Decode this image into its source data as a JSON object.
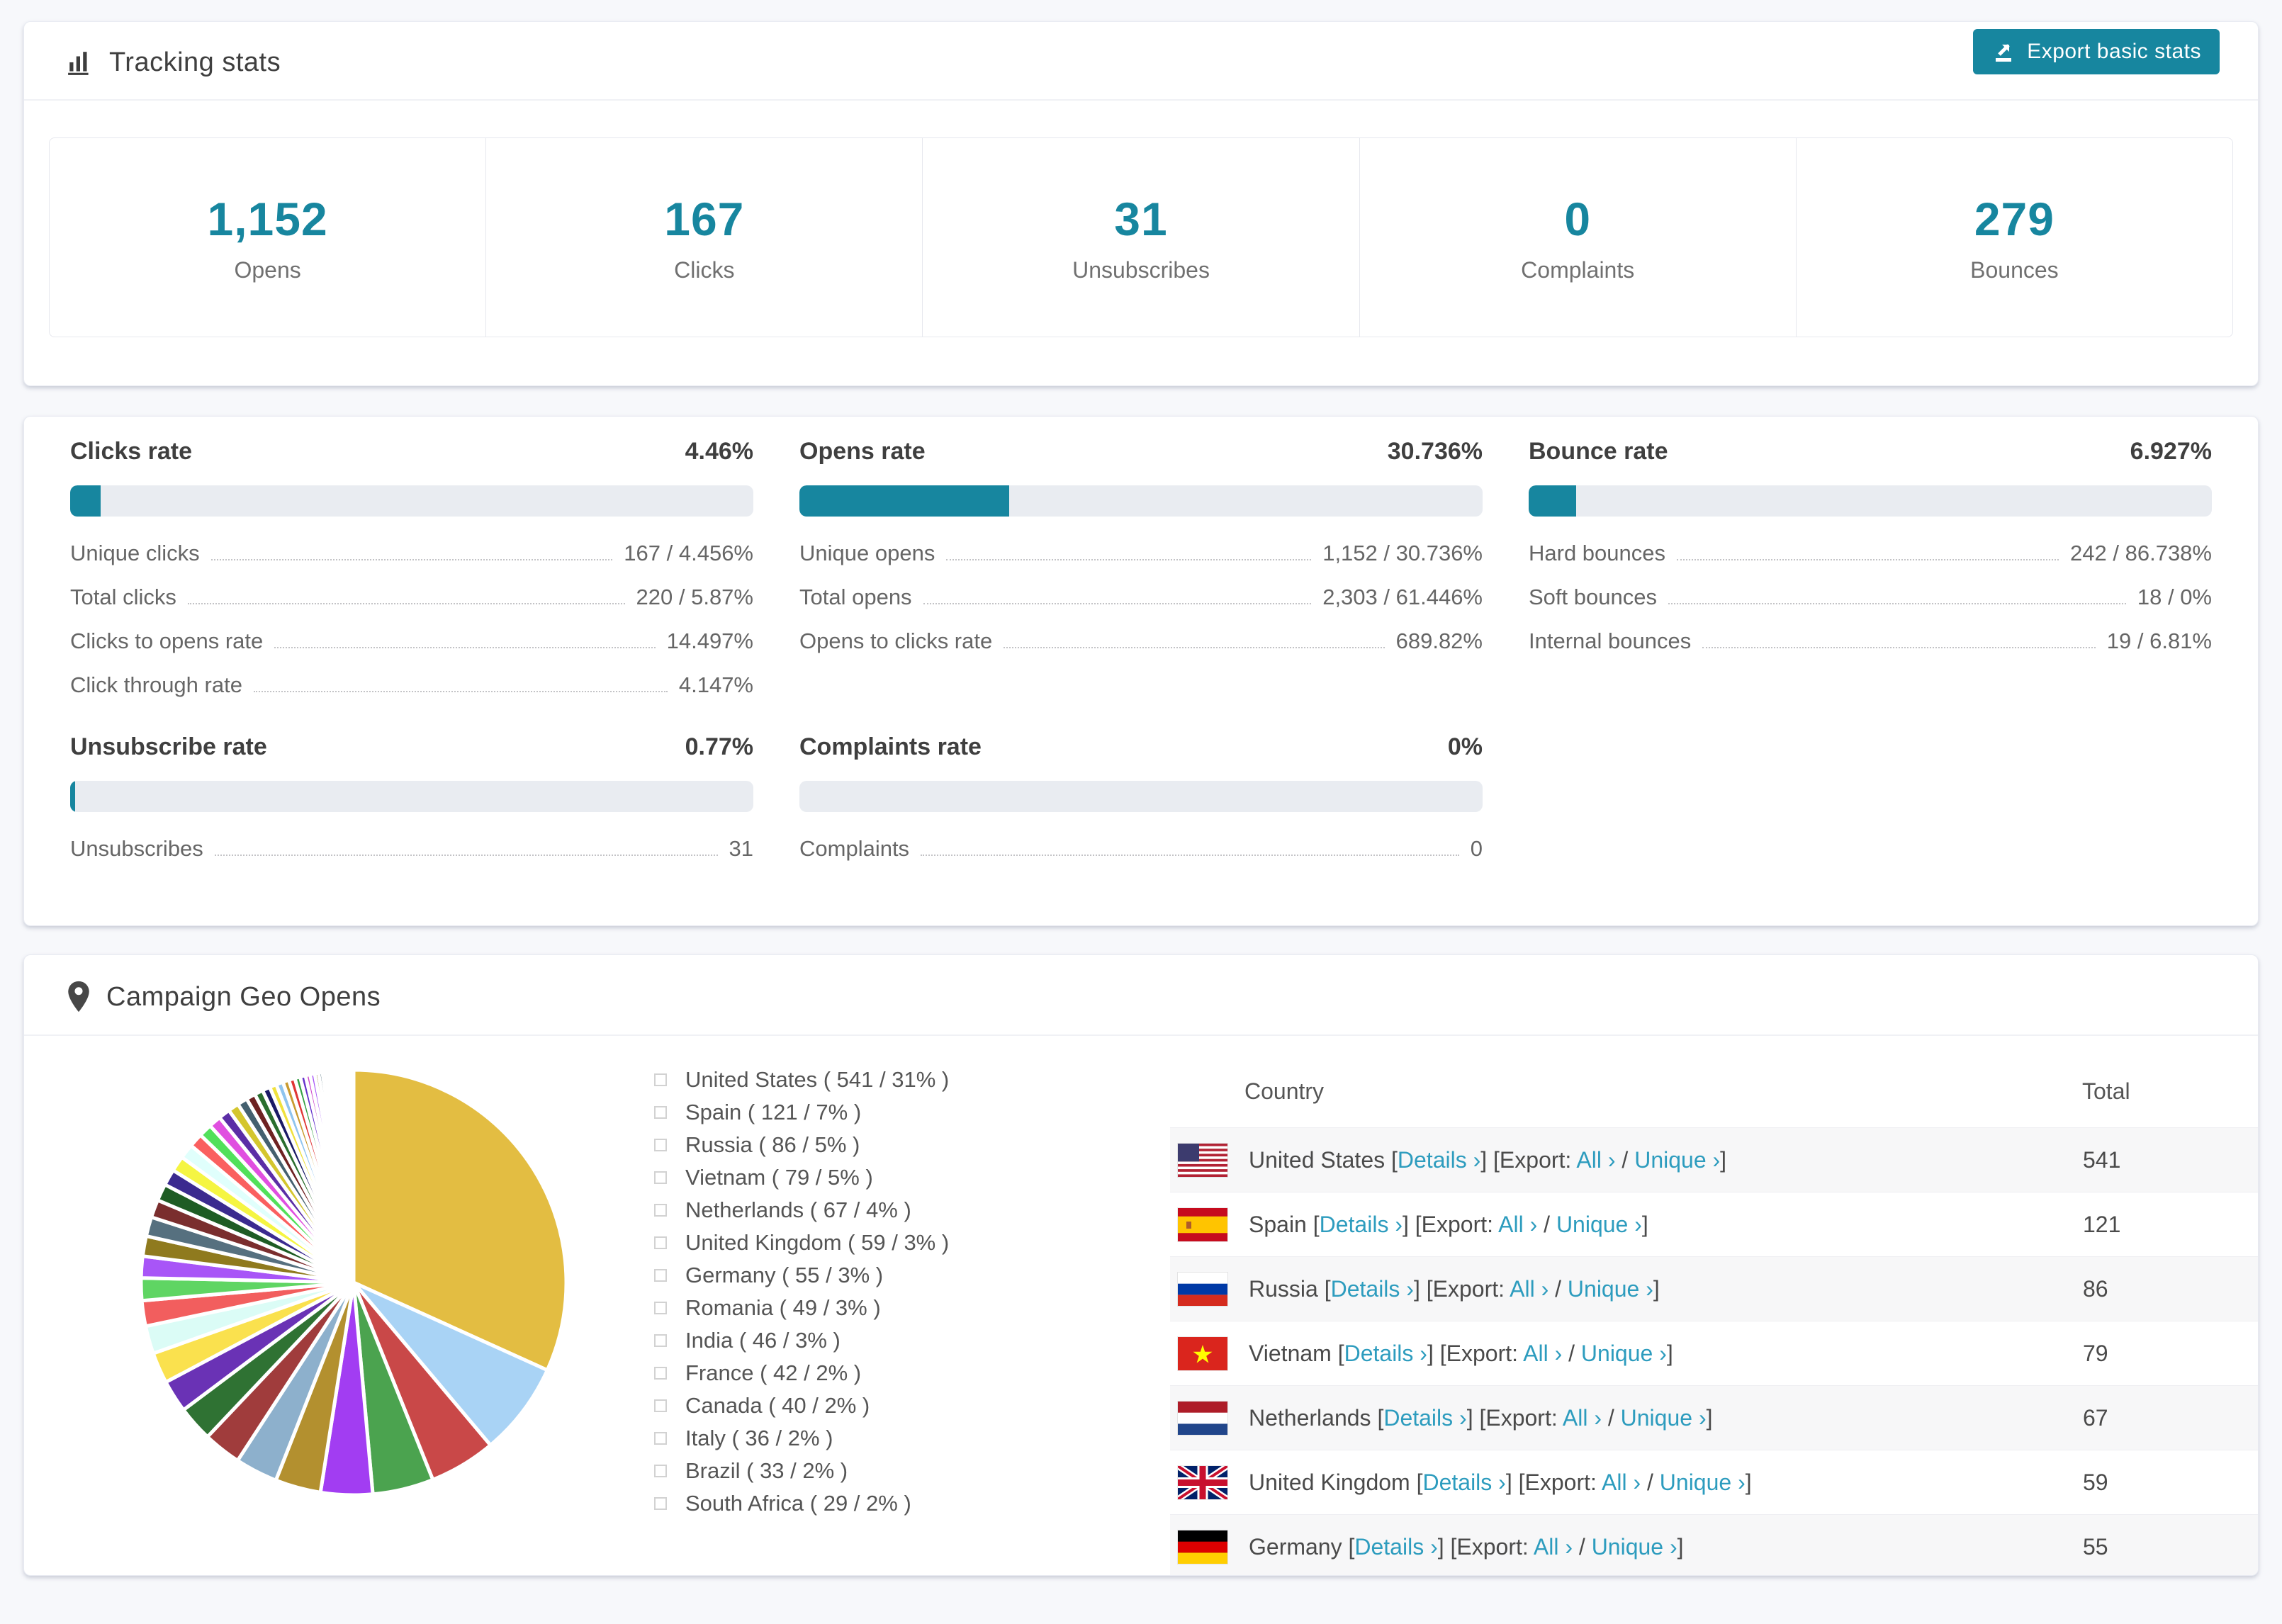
{
  "accent_color": "#17869f",
  "link_color": "#2d9cbe",
  "tracking": {
    "title": "Tracking stats",
    "export_button": "Export basic stats",
    "stats": [
      {
        "value": "1,152",
        "label": "Opens"
      },
      {
        "value": "167",
        "label": "Clicks"
      },
      {
        "value": "31",
        "label": "Unsubscribes"
      },
      {
        "value": "0",
        "label": "Complaints"
      },
      {
        "value": "279",
        "label": "Bounces"
      }
    ]
  },
  "rates": {
    "blocks": [
      {
        "title": "Clicks rate",
        "value": "4.46%",
        "percent": 4.46,
        "rows": [
          {
            "label": "Unique clicks",
            "value": "167 / 4.456%"
          },
          {
            "label": "Total clicks",
            "value": "220 / 5.87%"
          },
          {
            "label": "Clicks to opens rate",
            "value": "14.497%"
          },
          {
            "label": "Click through rate",
            "value": "4.147%"
          }
        ]
      },
      {
        "title": "Opens rate",
        "value": "30.736%",
        "percent": 30.736,
        "rows": [
          {
            "label": "Unique opens",
            "value": "1,152 / 30.736%"
          },
          {
            "label": "Total opens",
            "value": "2,303 / 61.446%"
          },
          {
            "label": "Opens to clicks rate",
            "value": "689.82%"
          }
        ]
      },
      {
        "title": "Bounce rate",
        "value": "6.927%",
        "percent": 6.927,
        "rows": [
          {
            "label": "Hard bounces",
            "value": "242 / 86.738%"
          },
          {
            "label": "Soft bounces",
            "value": "18 / 0%"
          },
          {
            "label": "Internal bounces",
            "value": "19 / 6.81%"
          }
        ]
      },
      {
        "title": "Unsubscribe rate",
        "value": "0.77%",
        "percent": 0.77,
        "rows": [
          {
            "label": "Unsubscribes",
            "value": "31"
          }
        ]
      },
      {
        "title": "Complaints rate",
        "value": "0%",
        "percent": 0,
        "rows": [
          {
            "label": "Complaints",
            "value": "0"
          }
        ]
      }
    ]
  },
  "geo": {
    "title": "Campaign Geo Opens",
    "table": {
      "col_country": "Country",
      "col_total": "Total",
      "details_label": "Details ›",
      "export_label": "Export:",
      "all_label": "All ›",
      "unique_label": "Unique ›",
      "rows": [
        {
          "country": "United States",
          "total": "541",
          "flag": "us"
        },
        {
          "country": "Spain",
          "total": "121",
          "flag": "es"
        },
        {
          "country": "Russia",
          "total": "86",
          "flag": "ru"
        },
        {
          "country": "Vietnam",
          "total": "79",
          "flag": "vn"
        },
        {
          "country": "Netherlands",
          "total": "67",
          "flag": "nl"
        },
        {
          "country": "United Kingdom",
          "total": "59",
          "flag": "gb"
        },
        {
          "country": "Germany",
          "total": "55",
          "flag": "de"
        }
      ]
    }
  },
  "chart_data": {
    "type": "pie",
    "title": "Campaign Geo Opens",
    "legend_position": "right",
    "start_angle_deg": 0,
    "series": [
      {
        "name": "United States",
        "value": 541,
        "pct": "31%",
        "color": "#e3bd42"
      },
      {
        "name": "Spain",
        "value": 121,
        "pct": "7%",
        "color": "#a9d3f5"
      },
      {
        "name": "Russia",
        "value": 86,
        "pct": "5%",
        "color": "#c94848"
      },
      {
        "name": "Vietnam",
        "value": 79,
        "pct": "5%",
        "color": "#4ba34f"
      },
      {
        "name": "Netherlands",
        "value": 67,
        "pct": "4%",
        "color": "#a23df2"
      },
      {
        "name": "United Kingdom",
        "value": 59,
        "pct": "3%",
        "color": "#b3902f"
      },
      {
        "name": "Germany",
        "value": 55,
        "pct": "3%",
        "color": "#8db0cc"
      },
      {
        "name": "Romania",
        "value": 49,
        "pct": "3%",
        "color": "#a03c3c"
      },
      {
        "name": "India",
        "value": 46,
        "pct": "3%",
        "color": "#2f7233"
      },
      {
        "name": "France",
        "value": 42,
        "pct": "2%",
        "color": "#6a32b5"
      },
      {
        "name": "Canada",
        "value": 40,
        "pct": "2%",
        "color": "#fae14e"
      },
      {
        "name": "Italy",
        "value": 36,
        "pct": "2%",
        "color": "#dbfcf6"
      },
      {
        "name": "Brazil",
        "value": 33,
        "pct": "2%",
        "color": "#f25e5e"
      },
      {
        "name": "South Africa",
        "value": 29,
        "pct": "2%",
        "color": "#5fd563"
      }
    ],
    "other_slices": {
      "values": [
        28,
        26,
        25,
        23,
        22,
        21,
        20,
        19,
        18,
        17,
        16,
        15,
        14,
        13,
        12,
        11,
        10,
        9,
        9,
        8,
        8,
        7,
        7,
        6,
        6,
        5,
        5,
        4,
        4,
        3,
        3,
        3,
        2,
        2,
        2,
        2,
        2,
        1,
        1,
        1,
        1,
        1,
        1,
        1,
        1,
        1,
        1,
        1,
        1,
        1
      ],
      "colors": [
        "#a855f7",
        "#8f7a1e",
        "#56707f",
        "#7a2e2e",
        "#1e5c24",
        "#3b2a8f",
        "#f5f542",
        "#e0fffc",
        "#fa5f5f",
        "#52e05a",
        "#e04fe0",
        "#5b2da6",
        "#d4c62e",
        "#44606f",
        "#6e2222",
        "#2a6e2e",
        "#1a1a66",
        "#f0e13d",
        "#8fc4ef",
        "#c99a2e",
        "#e03535",
        "#35a045",
        "#6633cc",
        "#cc44cc"
      ]
    }
  }
}
